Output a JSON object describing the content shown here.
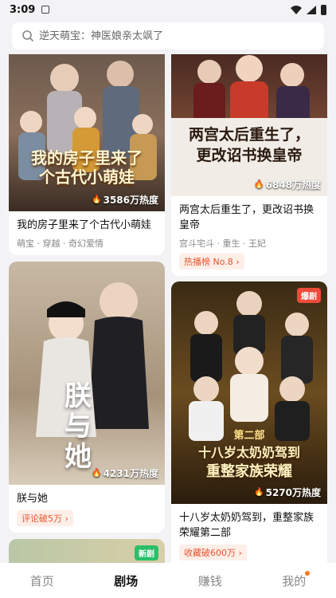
{
  "status_bar": {
    "time": "3:09"
  },
  "search": {
    "placeholder": "逆天萌宝：神医娘亲太飒了"
  },
  "cards": {
    "c1": {
      "title": "我的房子里来了个古代小萌娃",
      "tags": "萌宝 · 穿越 · 奇幻爱情",
      "heat": "3586万热度",
      "poster_text": [
        "我的房子里来了",
        "个古代小萌娃"
      ]
    },
    "c2": {
      "title": "两宫太后重生了，更改诏书换皇帝",
      "tags": "宫斗宅斗 · 重生 · 王妃",
      "rank": "热播榜 No.8",
      "heat": "6848万热度",
      "poster_text": [
        "两宫太后重生了，",
        "更改诏书换皇帝"
      ]
    },
    "c3": {
      "title": "朕与她",
      "rank": "评论破5万",
      "heat": "4231万热度",
      "poster_text": [
        "朕",
        "与",
        "她"
      ]
    },
    "c4": {
      "title": "十八岁太奶奶驾到，重整家族荣耀第二部",
      "rank": "收藏破600万",
      "heat": "5270万热度",
      "badge": "爆剧",
      "poster_text": [
        "第二部",
        "十八岁太奶奶驾到",
        "重整家族荣耀"
      ]
    },
    "c5": {
      "badge": "新剧"
    }
  },
  "tabbar": {
    "home": "首页",
    "theater": "剧场",
    "earn": "赚钱",
    "mine": "我的"
  },
  "colors": {
    "accent": "#e8542e",
    "badge_hot": "#f04a3a",
    "badge_new": "#2cbf6a",
    "dot": "#ff7a1a"
  }
}
